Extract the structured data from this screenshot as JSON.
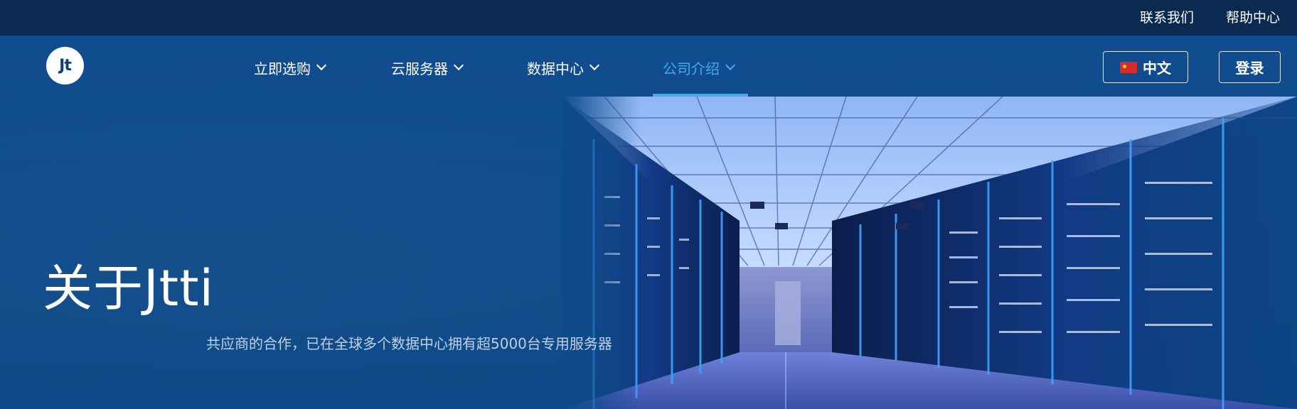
{
  "topbar": {
    "contact_label": "联系我们",
    "help_label": "帮助中心"
  },
  "logo": {
    "text": "Jt"
  },
  "nav": {
    "items": [
      {
        "label": "立即选购",
        "active": false
      },
      {
        "label": "云服务器",
        "active": false
      },
      {
        "label": "数据中心",
        "active": false
      },
      {
        "label": "公司介绍",
        "active": true
      }
    ],
    "language_label": "中文",
    "login_label": "登录"
  },
  "hero": {
    "title": "关于Jtti",
    "subtitle": "共应商的合作，已在全球多个数据中心拥有超5000台专用服务器"
  },
  "colors": {
    "topbar_bg": "#0b2a52",
    "hero_bg": "#0e4b8a",
    "accent": "#49a9e8",
    "flag_red": "#d62b2b"
  },
  "icons": {
    "chevron": "chevron-down-icon",
    "flag": "china-flag-icon"
  }
}
